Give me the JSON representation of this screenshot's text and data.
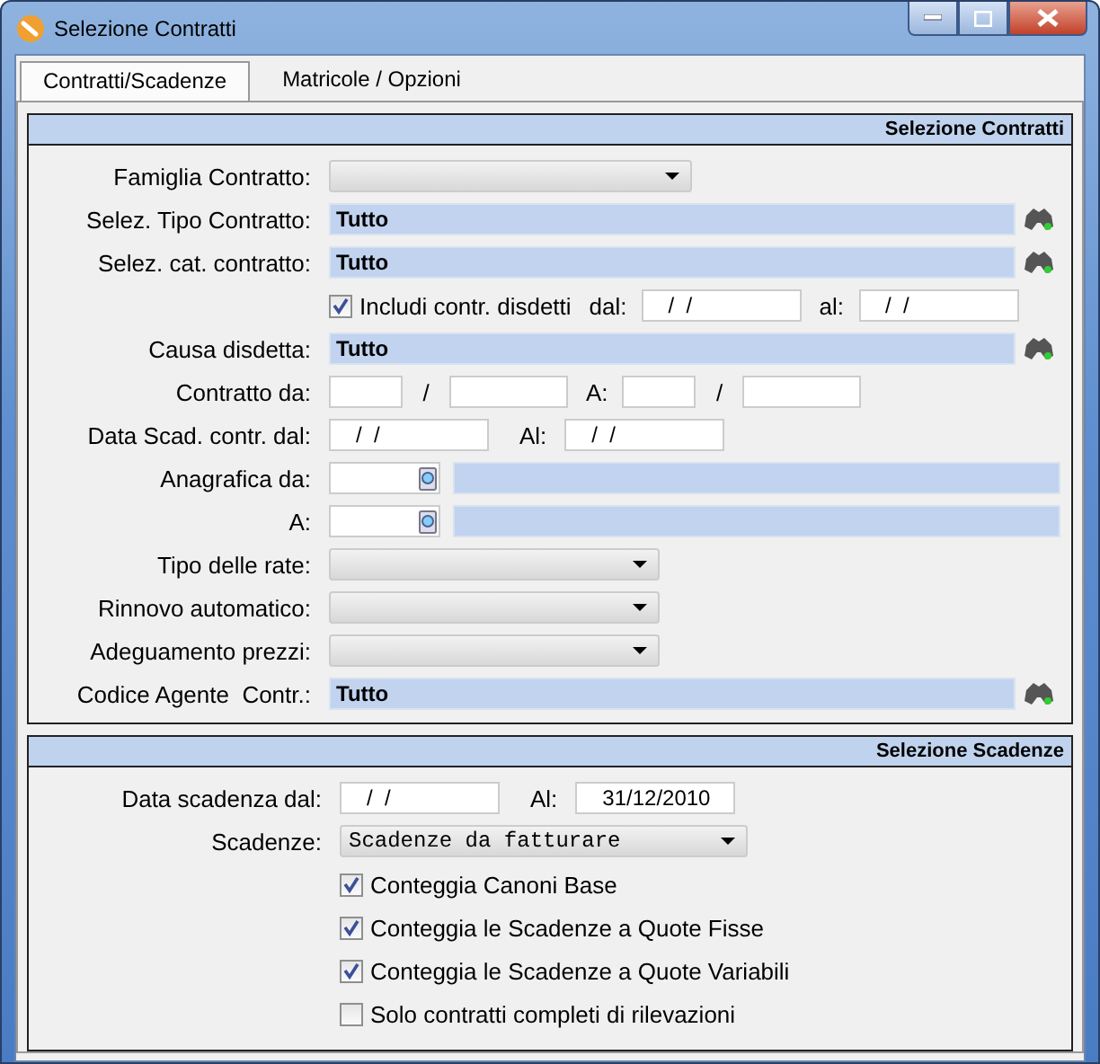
{
  "window": {
    "title": "Selezione Contratti"
  },
  "tabs": [
    {
      "label": "Contratti/Scadenze",
      "selected": true
    },
    {
      "label": "Matricole / Opzioni",
      "selected": false
    }
  ],
  "sections": [
    {
      "title": "Selezione Contratti",
      "rows": [
        {
          "kind": "dropdown",
          "label": "Famiglia Contratto:"
        },
        {
          "kind": "lookup",
          "label": "Selez. Tipo Contratto:",
          "value": "Tutto"
        },
        {
          "kind": "lookup",
          "label": "Selez. cat. contratto:",
          "value": "Tutto"
        },
        {
          "kind": "check_dates",
          "checkbox": {
            "label": "Includi contr. disdetti",
            "checked": true
          },
          "from_label": "dal:",
          "from": "/  /",
          "to_label": "al:",
          "to": "/  /"
        },
        {
          "kind": "lookup",
          "label": "Causa disdetta:",
          "value": "Tutto"
        },
        {
          "kind": "range",
          "label": "Contratto da:",
          "separator": "/",
          "to_label": "A:",
          "separator_2": "/"
        },
        {
          "kind": "dates",
          "label": "Data Scad. contr. dal:",
          "from": "/  /",
          "to_label": "Al:",
          "to": "/  /"
        },
        {
          "kind": "anagrafica",
          "label": "Anagrafica da:"
        },
        {
          "kind": "anagrafica",
          "label": "A:"
        },
        {
          "kind": "dropdown",
          "label": "Tipo delle rate:"
        },
        {
          "kind": "dropdown",
          "label": "Rinnovo automatico:"
        },
        {
          "kind": "dropdown",
          "label": "Adeguamento prezzi:"
        },
        {
          "kind": "lookup",
          "label": "Codice Agente  Contr.:",
          "value": "Tutto"
        }
      ]
    },
    {
      "title": "Selezione Scadenze",
      "rows": [
        {
          "kind": "dates",
          "label": "Data scadenza dal:",
          "from": "/  /",
          "to_label": "Al:",
          "to": "31/12/2010"
        },
        {
          "kind": "dropdown",
          "label": "Scadenze:",
          "value": "Scadenze da fatturare"
        },
        {
          "kind": "checkbox",
          "label": "Conteggia Canoni Base",
          "checked": true
        },
        {
          "kind": "checkbox",
          "label": "Conteggia le Scadenze a Quote Fisse",
          "checked": true
        },
        {
          "kind": "checkbox",
          "label": "Conteggia le Scadenze a Quote Variabili",
          "checked": true
        },
        {
          "kind": "checkbox",
          "label": "Solo contratti completi di rilevazioni",
          "checked": false
        }
      ]
    }
  ]
}
